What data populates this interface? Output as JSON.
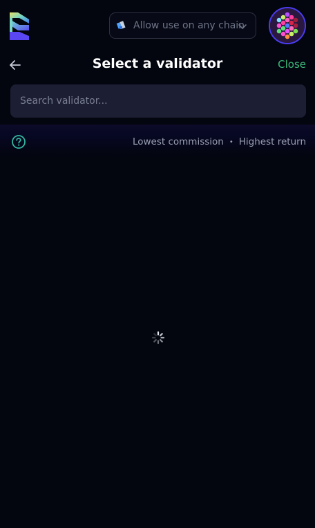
{
  "topbar": {
    "logo_icon": "stacked-layers-logo-icon",
    "chain_selector": {
      "label": "Allow use on any chain",
      "icon": "chain-icon",
      "chevron": "chevron-down-icon"
    },
    "avatar_icon": "identicon-avatar"
  },
  "header": {
    "back_icon": "arrow-left-icon",
    "title": "Select a validator",
    "close_label": "Close"
  },
  "search": {
    "placeholder": "Search validator..."
  },
  "sort": {
    "help_icon": "question-circle-icon",
    "options": [
      "Lowest commission",
      "Highest return"
    ],
    "separator": "•"
  },
  "loading": {
    "icon": "spinner-icon"
  },
  "colors": {
    "background": "#03050f",
    "accent_green": "#3dba7a",
    "search_bg": "#1c1e33",
    "help_teal": "#33b7a3",
    "avatar_ring": "#4a3df0"
  }
}
